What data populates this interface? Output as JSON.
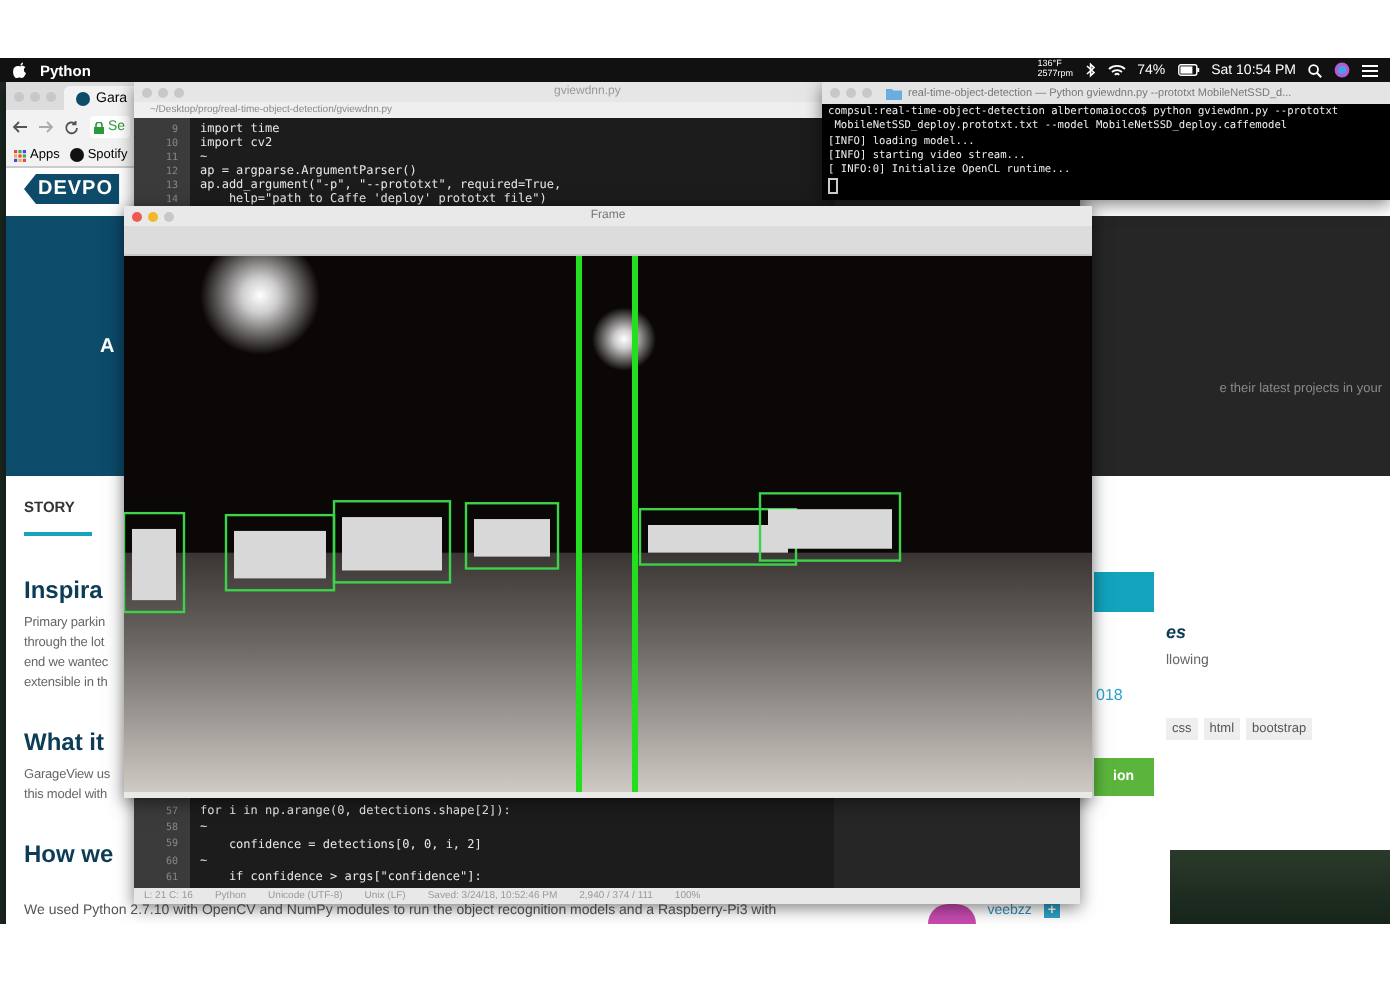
{
  "menubar": {
    "app": "Python",
    "sensor_lines": [
      "136°F",
      "2577rpm"
    ],
    "battery": "74%",
    "clock": "Sat 10:54 PM"
  },
  "browser": {
    "tab": "Gara",
    "address": "Se",
    "bookmarks": [
      "Apps",
      "Spotify"
    ],
    "logo": "DEVPO",
    "banner_text": "A",
    "banner_right_text": "e their latest projects in your",
    "story_tab": {
      "label": "STORY",
      "selected": true
    },
    "sections": [
      {
        "heading": "Inspira",
        "lines": [
          "Primary parkin",
          "through the lot",
          "end we wantec",
          "extensible in th"
        ]
      },
      {
        "heading": "What it",
        "lines": [
          "GarageView us",
          "this model with"
        ]
      },
      {
        "heading": "How we"
      }
    ],
    "bottom_paragraph": "We used Python 2.7.10 with OpenCV and NumPy modules to run the object recognition models and a Raspberry-Pi3 with",
    "sidebar": {
      "heading": "es",
      "text": "llowing",
      "date": "018",
      "tags": [
        "css",
        "html",
        "bootstrap"
      ],
      "action_button": "ion"
    },
    "user": {
      "name": "veebzz",
      "badge": "+"
    }
  },
  "editor": {
    "title": "gviewdnn.py",
    "path": "~/Desktop/prog/real-time-object-detection/gviewdnn.py",
    "top_lines": [
      {
        "number": "9",
        "code": "import time"
      },
      {
        "number": "10",
        "code": "import cv2"
      },
      {
        "number": "11",
        "code": "~"
      },
      {
        "number": "12",
        "code": "ap = argparse.ArgumentParser()"
      },
      {
        "number": "13",
        "code": "ap.add_argument(\"-p\", \"--prototxt\", required=True,"
      },
      {
        "number": "14",
        "code": "    help=\"path to Caffe 'deploy' prototxt file\")"
      }
    ],
    "bottom_lines": [
      {
        "number": "57",
        "code": "for i in np.arange(0, detections.shape[2]):"
      },
      {
        "number": "58",
        "code": "~"
      },
      {
        "number": "59",
        "code": "    confidence = detections[0, 0, i, 2]"
      },
      {
        "number": "60",
        "code": "~"
      },
      {
        "number": "61",
        "code": "    if confidence > args[\"confidence\"]:"
      }
    ],
    "status": [
      "L: 21 C: 16",
      "Python",
      "Unicode (UTF-8)",
      "Unix (LF)",
      "Saved: 3/24/18, 10:52:46 PM",
      "2,940 / 374 / 111",
      "100%"
    ]
  },
  "terminal": {
    "title": "real-time-object-detection — Python gviewdnn.py --prototxt MobileNetSSD_d...",
    "lines": [
      "compsul:real-time-object-detection albertomaiocco$ python gviewdnn.py --prototxt",
      " MobileNetSSD_deploy.prototxt.txt --model MobileNetSSD_deploy.caffemodel",
      "[INFO] loading model...",
      "[INFO] starting video stream...",
      "[ INFO:0] Initialize OpenCL runtime..."
    ]
  },
  "frame_window": {
    "title": "Frame"
  }
}
